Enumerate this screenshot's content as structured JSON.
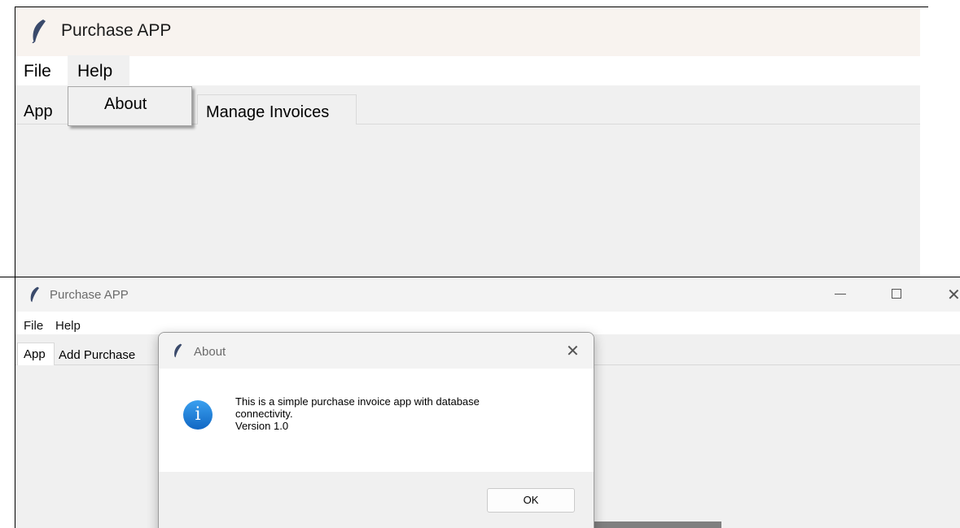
{
  "top_window": {
    "title": "Purchase APP",
    "menu": [
      "File",
      "Help"
    ],
    "dropdown_item": "About",
    "tabs": [
      "App",
      "Manage Invoices"
    ]
  },
  "bottom_window": {
    "title": "Purchase APP",
    "menu": [
      "File",
      "Help"
    ],
    "tabs": [
      "App",
      "Add Purchase"
    ],
    "controls": {
      "minimize": "—",
      "maximize": "☐",
      "close": "✕"
    }
  },
  "about_dialog": {
    "title": "About",
    "close_glyph": "✕",
    "info_glyph": "i",
    "message_lines": [
      "This is a simple purchase invoice app with database",
      "connectivity.",
      "Version 1.0"
    ],
    "ok_label": "OK"
  },
  "icons": [
    "feather-icon",
    "info-icon",
    "close-icon",
    "minimize-icon",
    "maximize-icon"
  ],
  "colors": {
    "accent_info": "#1e7ed8",
    "titlebar": "#f8f3ef",
    "window_bg": "#f0f0f0"
  }
}
